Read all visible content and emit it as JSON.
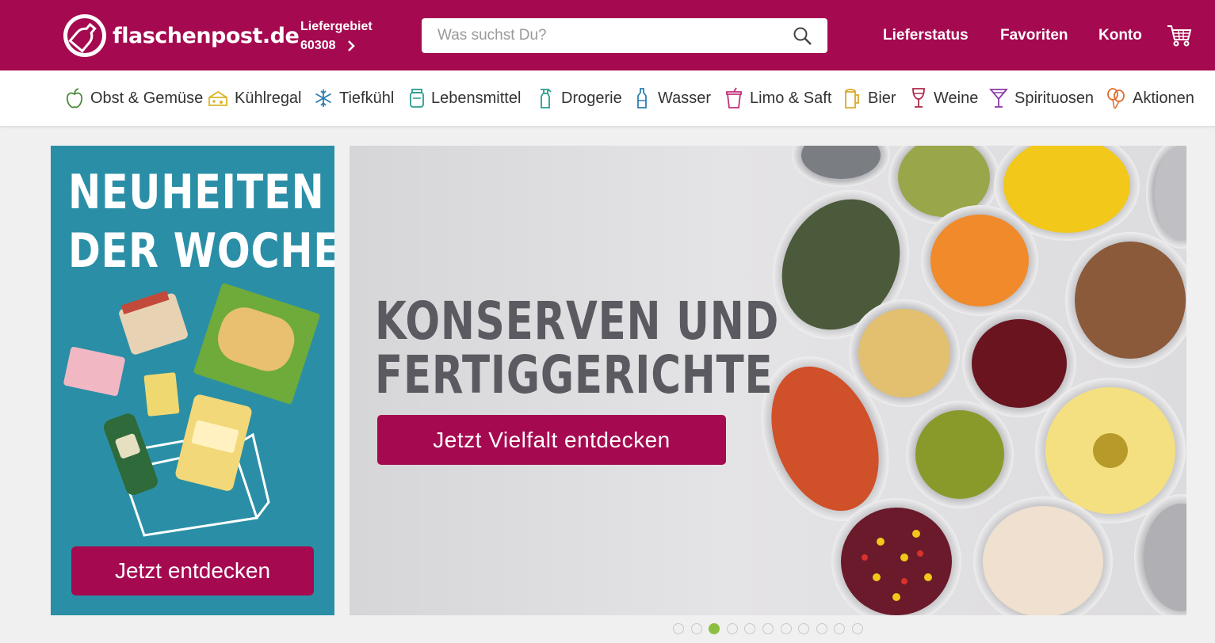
{
  "header": {
    "logo_text": "flaschenpost.de",
    "delivery_label": "Liefergebiet",
    "delivery_zip": "60308",
    "search_placeholder": "Was suchst Du?",
    "nav": [
      "Lieferstatus",
      "Favoriten",
      "Konto"
    ]
  },
  "categories": [
    {
      "label": "Obst & Gemüse",
      "icon": "apple-icon"
    },
    {
      "label": "Kühlregal",
      "icon": "cheese-icon"
    },
    {
      "label": "Tiefkühl",
      "icon": "snowflake-icon"
    },
    {
      "label": "Lebensmittel",
      "icon": "jar-icon"
    },
    {
      "label": "Drogerie",
      "icon": "spray-bottle-icon"
    },
    {
      "label": "Wasser",
      "icon": "water-bottle-icon"
    },
    {
      "label": "Limo & Saft",
      "icon": "soda-cup-icon"
    },
    {
      "label": "Bier",
      "icon": "beer-icon"
    },
    {
      "label": "Weine",
      "icon": "wine-glass-icon"
    },
    {
      "label": "Spirituosen",
      "icon": "cocktail-icon"
    },
    {
      "label": "Aktionen",
      "icon": "balloons-icon"
    }
  ],
  "left_banner": {
    "line1": "NEUHEITEN",
    "line2": "DER WOCHE",
    "button": "Jetzt entdecken"
  },
  "hero": {
    "line1": "KONSERVEN UND",
    "line2": "FERTIGGERICHTE",
    "button": "Jetzt Vielfalt entdecken"
  },
  "carousel": {
    "count": 11,
    "active_index": 2
  },
  "colors": {
    "brand": "#a50a50",
    "accent_green": "#8cbf3f",
    "banner_teal": "#2a8fa6"
  }
}
